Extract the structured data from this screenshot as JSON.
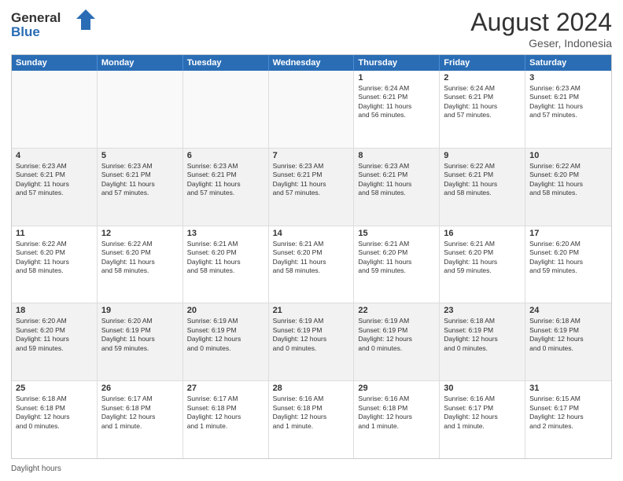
{
  "logo": {
    "general": "General",
    "blue": "Blue"
  },
  "header": {
    "month_year": "August 2024",
    "location": "Geser, Indonesia"
  },
  "days_of_week": [
    "Sunday",
    "Monday",
    "Tuesday",
    "Wednesday",
    "Thursday",
    "Friday",
    "Saturday"
  ],
  "footer": {
    "daylight_label": "Daylight hours"
  },
  "weeks": [
    {
      "cells": [
        {
          "day": "",
          "info": ""
        },
        {
          "day": "",
          "info": ""
        },
        {
          "day": "",
          "info": ""
        },
        {
          "day": "",
          "info": ""
        },
        {
          "day": "1",
          "info": "Sunrise: 6:24 AM\nSunset: 6:21 PM\nDaylight: 11 hours\nand 56 minutes."
        },
        {
          "day": "2",
          "info": "Sunrise: 6:24 AM\nSunset: 6:21 PM\nDaylight: 11 hours\nand 57 minutes."
        },
        {
          "day": "3",
          "info": "Sunrise: 6:23 AM\nSunset: 6:21 PM\nDaylight: 11 hours\nand 57 minutes."
        }
      ]
    },
    {
      "cells": [
        {
          "day": "4",
          "info": "Sunrise: 6:23 AM\nSunset: 6:21 PM\nDaylight: 11 hours\nand 57 minutes."
        },
        {
          "day": "5",
          "info": "Sunrise: 6:23 AM\nSunset: 6:21 PM\nDaylight: 11 hours\nand 57 minutes."
        },
        {
          "day": "6",
          "info": "Sunrise: 6:23 AM\nSunset: 6:21 PM\nDaylight: 11 hours\nand 57 minutes."
        },
        {
          "day": "7",
          "info": "Sunrise: 6:23 AM\nSunset: 6:21 PM\nDaylight: 11 hours\nand 57 minutes."
        },
        {
          "day": "8",
          "info": "Sunrise: 6:23 AM\nSunset: 6:21 PM\nDaylight: 11 hours\nand 58 minutes."
        },
        {
          "day": "9",
          "info": "Sunrise: 6:22 AM\nSunset: 6:21 PM\nDaylight: 11 hours\nand 58 minutes."
        },
        {
          "day": "10",
          "info": "Sunrise: 6:22 AM\nSunset: 6:20 PM\nDaylight: 11 hours\nand 58 minutes."
        }
      ]
    },
    {
      "cells": [
        {
          "day": "11",
          "info": "Sunrise: 6:22 AM\nSunset: 6:20 PM\nDaylight: 11 hours\nand 58 minutes."
        },
        {
          "day": "12",
          "info": "Sunrise: 6:22 AM\nSunset: 6:20 PM\nDaylight: 11 hours\nand 58 minutes."
        },
        {
          "day": "13",
          "info": "Sunrise: 6:21 AM\nSunset: 6:20 PM\nDaylight: 11 hours\nand 58 minutes."
        },
        {
          "day": "14",
          "info": "Sunrise: 6:21 AM\nSunset: 6:20 PM\nDaylight: 11 hours\nand 58 minutes."
        },
        {
          "day": "15",
          "info": "Sunrise: 6:21 AM\nSunset: 6:20 PM\nDaylight: 11 hours\nand 59 minutes."
        },
        {
          "day": "16",
          "info": "Sunrise: 6:21 AM\nSunset: 6:20 PM\nDaylight: 11 hours\nand 59 minutes."
        },
        {
          "day": "17",
          "info": "Sunrise: 6:20 AM\nSunset: 6:20 PM\nDaylight: 11 hours\nand 59 minutes."
        }
      ]
    },
    {
      "cells": [
        {
          "day": "18",
          "info": "Sunrise: 6:20 AM\nSunset: 6:20 PM\nDaylight: 11 hours\nand 59 minutes."
        },
        {
          "day": "19",
          "info": "Sunrise: 6:20 AM\nSunset: 6:19 PM\nDaylight: 11 hours\nand 59 minutes."
        },
        {
          "day": "20",
          "info": "Sunrise: 6:19 AM\nSunset: 6:19 PM\nDaylight: 12 hours\nand 0 minutes."
        },
        {
          "day": "21",
          "info": "Sunrise: 6:19 AM\nSunset: 6:19 PM\nDaylight: 12 hours\nand 0 minutes."
        },
        {
          "day": "22",
          "info": "Sunrise: 6:19 AM\nSunset: 6:19 PM\nDaylight: 12 hours\nand 0 minutes."
        },
        {
          "day": "23",
          "info": "Sunrise: 6:18 AM\nSunset: 6:19 PM\nDaylight: 12 hours\nand 0 minutes."
        },
        {
          "day": "24",
          "info": "Sunrise: 6:18 AM\nSunset: 6:19 PM\nDaylight: 12 hours\nand 0 minutes."
        }
      ]
    },
    {
      "cells": [
        {
          "day": "25",
          "info": "Sunrise: 6:18 AM\nSunset: 6:18 PM\nDaylight: 12 hours\nand 0 minutes."
        },
        {
          "day": "26",
          "info": "Sunrise: 6:17 AM\nSunset: 6:18 PM\nDaylight: 12 hours\nand 1 minute."
        },
        {
          "day": "27",
          "info": "Sunrise: 6:17 AM\nSunset: 6:18 PM\nDaylight: 12 hours\nand 1 minute."
        },
        {
          "day": "28",
          "info": "Sunrise: 6:16 AM\nSunset: 6:18 PM\nDaylight: 12 hours\nand 1 minute."
        },
        {
          "day": "29",
          "info": "Sunrise: 6:16 AM\nSunset: 6:18 PM\nDaylight: 12 hours\nand 1 minute."
        },
        {
          "day": "30",
          "info": "Sunrise: 6:16 AM\nSunset: 6:17 PM\nDaylight: 12 hours\nand 1 minute."
        },
        {
          "day": "31",
          "info": "Sunrise: 6:15 AM\nSunset: 6:17 PM\nDaylight: 12 hours\nand 2 minutes."
        }
      ]
    }
  ]
}
